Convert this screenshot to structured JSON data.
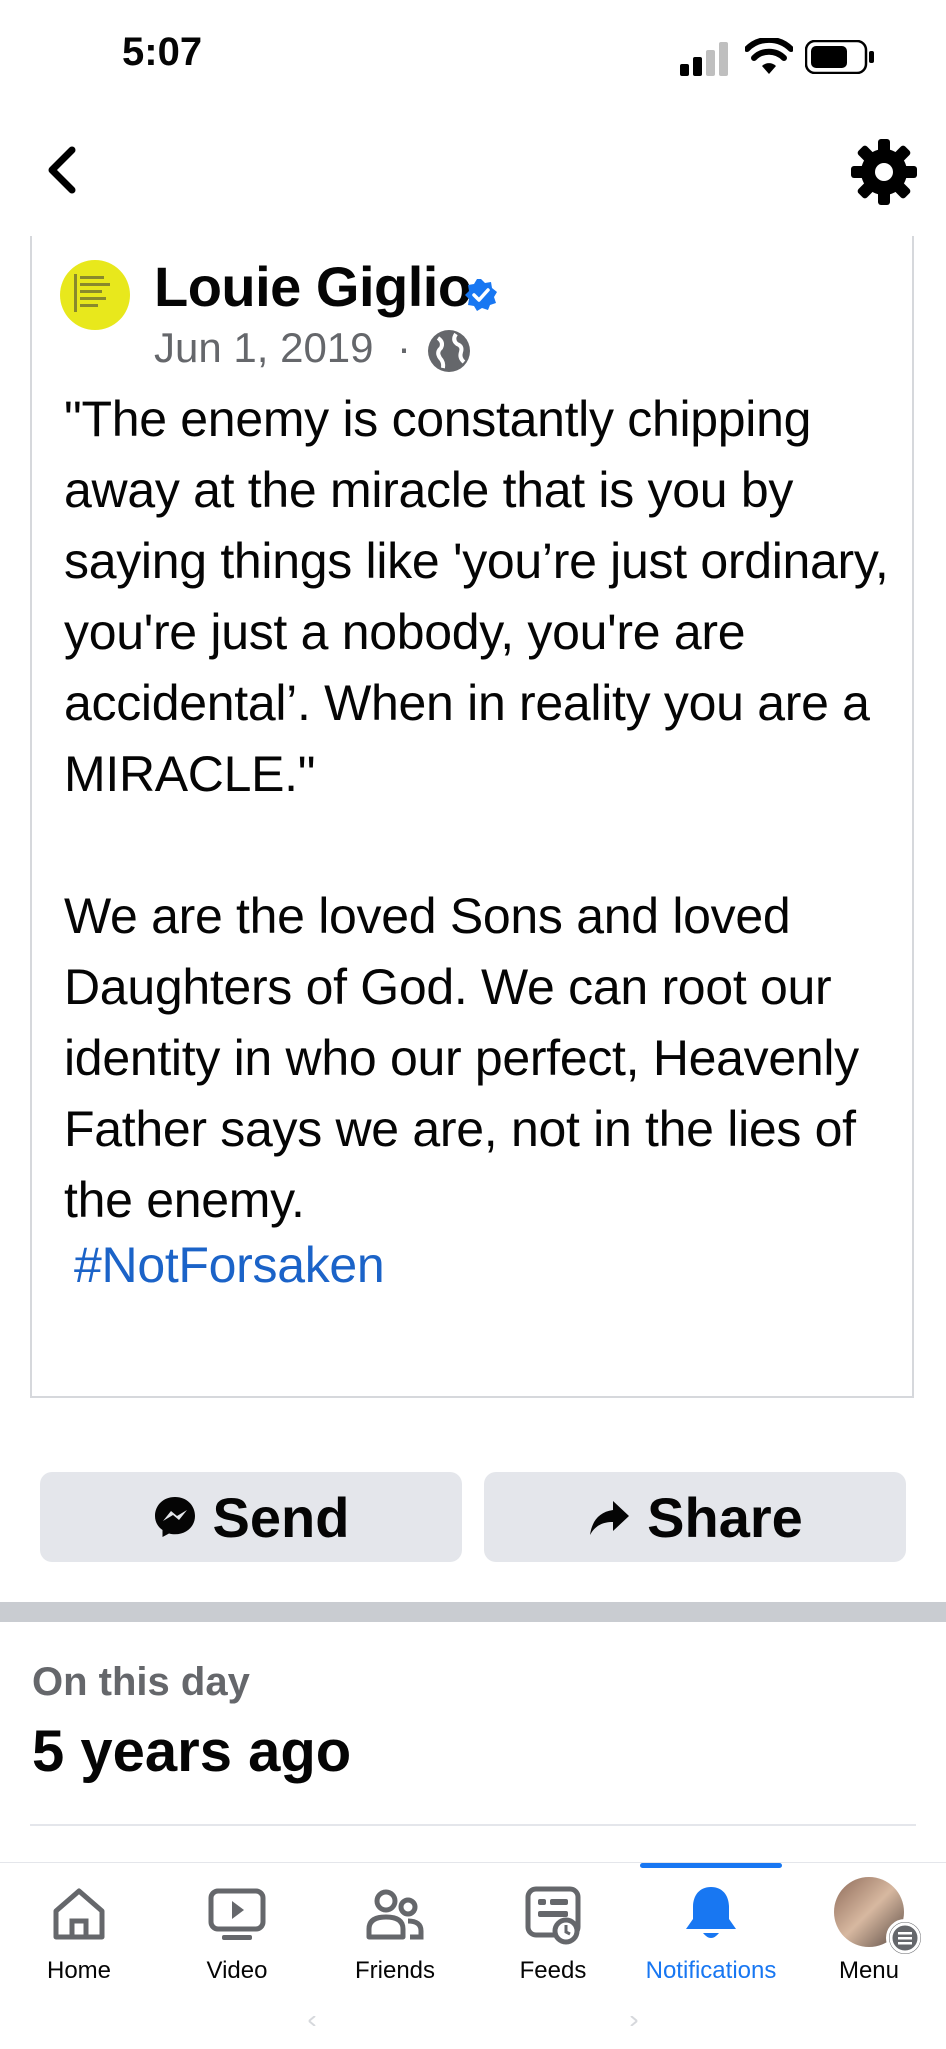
{
  "status_bar": {
    "time": "5:07"
  },
  "post": {
    "author": "Louie Giglio",
    "date": "Jun 1, 2019",
    "separator": "·",
    "body": "\"The enemy is constantly chipping away at the miracle that is you by saying things like 'you’re just ordinary, you're just a nobody, you're are accidental’. When in reality you are a MIRACLE.\"\n\nWe are the loved Sons and loved Daughters of God. We can root our identity in who our perfect, Heavenly Father says we are, not in the lies of the enemy.",
    "hashtag": "#NotForsaken"
  },
  "actions": {
    "send_label": "Send",
    "share_label": "Share"
  },
  "memories": {
    "label": "On this day",
    "title": "5 years ago"
  },
  "tabs": [
    {
      "label": "Home",
      "icon": "home-icon"
    },
    {
      "label": "Video",
      "icon": "video-icon"
    },
    {
      "label": "Friends",
      "icon": "friends-icon"
    },
    {
      "label": "Feeds",
      "icon": "feeds-icon"
    },
    {
      "label": "Notifications",
      "icon": "bell-icon",
      "active": true
    },
    {
      "label": "Menu",
      "icon": "avatar"
    }
  ],
  "colors": {
    "accent": "#1877f2",
    "hashtag": "#1b63c8",
    "button_bg": "#e4e6eb",
    "muted": "#65676b"
  }
}
